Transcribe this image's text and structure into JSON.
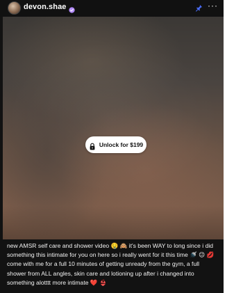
{
  "post": {
    "username": "devon.shae",
    "verified_icon": "verified-badge-icon",
    "pin_icon": "pin-icon",
    "more_icon": "more-horizontal-icon",
    "more_label": "···",
    "unlock": {
      "icon": "lock-icon",
      "label": "Unlock for $199"
    },
    "caption": "new AMSR self care and shower video 🤤 🙈 it's been WAY to long since i did something this intimate for you on here so i really went for it this time 🚿 😉 💋  come with me for a full 10 minutes of getting unready from the gym, a full shower from ALL angles, skin care and lotioning up after i changed into something alotttt more intimate ❤️ 👙"
  },
  "colors": {
    "background": "#121212",
    "accent_pin": "#4a6cf7",
    "verified": "#b48cff"
  }
}
